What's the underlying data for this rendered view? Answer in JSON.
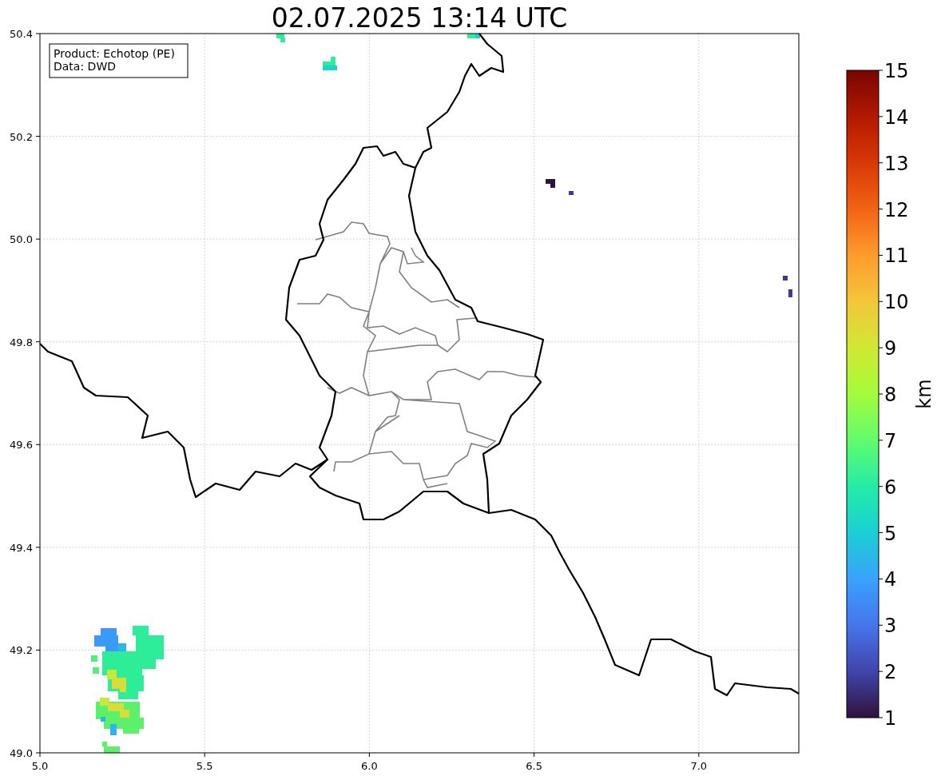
{
  "title": "02.07.2025 13:14 UTC",
  "legend": [
    "Product: Echotop (PE)",
    "Data: DWD"
  ],
  "x_axis": {
    "tick_labels": [
      "5.0",
      "5.5",
      "6.0",
      "6.5",
      "7.0"
    ]
  },
  "y_axis": {
    "tick_labels": [
      "50.4",
      "50.2",
      "50.0",
      "49.8",
      "49.6",
      "49.4",
      "49.2",
      "49.0"
    ]
  },
  "colorbar": {
    "label": "km",
    "tick_labels": [
      "15",
      "14",
      "13",
      "12",
      "11",
      "10",
      "9",
      "8",
      "7",
      "6",
      "5",
      "4",
      "3",
      "2",
      "1"
    ]
  }
}
